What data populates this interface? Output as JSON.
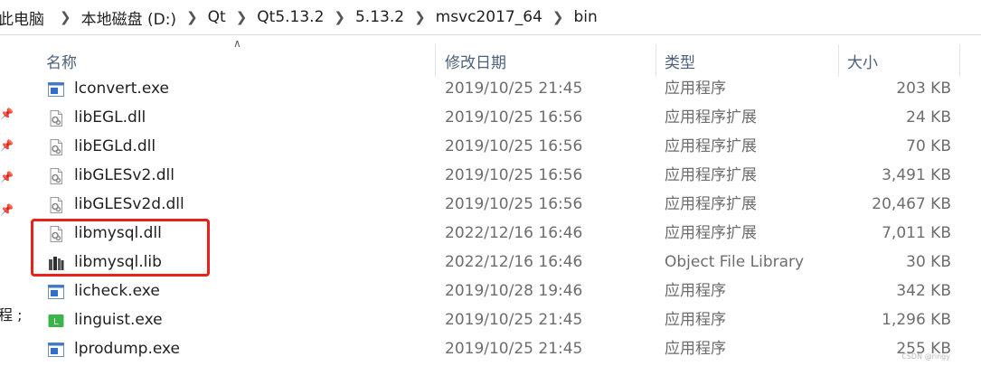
{
  "breadcrumb": [
    "此电脑",
    "本地磁盘 (D:)",
    "Qt",
    "Qt5.13.2",
    "5.13.2",
    "msvc2017_64",
    "bin"
  ],
  "nav": {
    "partial_label": "程 ;"
  },
  "columns": {
    "name": "名称",
    "date": "修改日期",
    "type": "类型",
    "size": "大小"
  },
  "files": [
    {
      "name": "lconvert.exe",
      "date": "2019/10/25 21:45",
      "type": "应用程序",
      "size": "203 KB",
      "icon": "exe-icon"
    },
    {
      "name": "libEGL.dll",
      "date": "2019/10/25 16:56",
      "type": "应用程序扩展",
      "size": "24 KB",
      "icon": "dll-icon"
    },
    {
      "name": "libEGLd.dll",
      "date": "2019/10/25 16:56",
      "type": "应用程序扩展",
      "size": "70 KB",
      "icon": "dll-icon"
    },
    {
      "name": "libGLESv2.dll",
      "date": "2019/10/25 16:56",
      "type": "应用程序扩展",
      "size": "3,491 KB",
      "icon": "dll-icon"
    },
    {
      "name": "libGLESv2d.dll",
      "date": "2019/10/25 16:56",
      "type": "应用程序扩展",
      "size": "20,467 KB",
      "icon": "dll-icon"
    },
    {
      "name": "libmysql.dll",
      "date": "2022/12/16 16:46",
      "type": "应用程序扩展",
      "size": "7,011 KB",
      "icon": "dll-icon"
    },
    {
      "name": "libmysql.lib",
      "date": "2022/12/16 16:46",
      "type": "Object File Library",
      "size": "30 KB",
      "icon": "lib-icon"
    },
    {
      "name": "licheck.exe",
      "date": "2019/10/28 19:46",
      "type": "应用程序",
      "size": "342 KB",
      "icon": "exe-icon"
    },
    {
      "name": "linguist.exe",
      "date": "2019/10/25 21:45",
      "type": "应用程序",
      "size": "1,296 KB",
      "icon": "linguist-icon"
    },
    {
      "name": "lprodump.exe",
      "date": "2019/10/25 21:45",
      "type": "应用程序",
      "size": "255 KB",
      "icon": "exe-icon"
    }
  ],
  "watermark": "CSDN @ringy",
  "colors": {
    "highlight": "#e8221b",
    "header_text": "#4c607a"
  }
}
